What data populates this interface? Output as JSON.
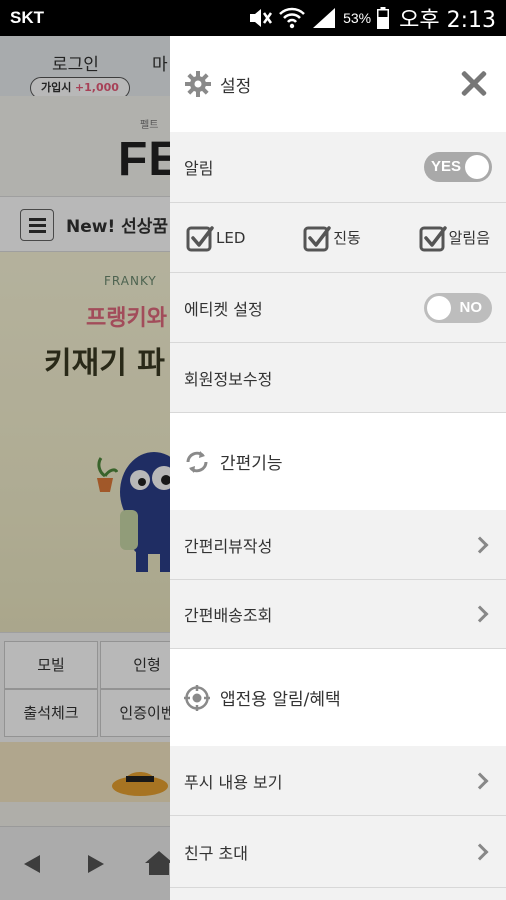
{
  "status_bar": {
    "carrier": "SKT",
    "battery_percent": "53%",
    "time": "오후 2:13"
  },
  "background_app": {
    "login": "로그인",
    "my_page_partial": "마",
    "join_badge_prefix": "가입시",
    "join_badge_points": "+1,000",
    "logo_small": "펠트",
    "logo": "FE",
    "notice": "New! 선상꿈",
    "banner_brand": "FRANKY",
    "banner_line1": "프랭키와",
    "banner_line2": "키재기 파",
    "grid": [
      "모빌",
      "인형",
      "출석체크",
      "인증이벤"
    ]
  },
  "drawer": {
    "header": {
      "title": "설정",
      "icon": "gear-icon",
      "close_icon": "close-icon"
    },
    "notification": {
      "label": "알림",
      "toggle_label": "YES",
      "toggle_state": "on"
    },
    "notification_options": [
      {
        "label": "LED",
        "checked": true
      },
      {
        "label": "진동",
        "checked": true
      },
      {
        "label": "알림음",
        "checked": true
      }
    ],
    "etiquette": {
      "label": "에티켓 설정",
      "toggle_label": "NO",
      "toggle_state": "off"
    },
    "member_info": {
      "label": "회원정보수정"
    },
    "quick_section": {
      "title": "간편기능",
      "icon": "refresh-icon"
    },
    "quick_items": [
      {
        "label": "간편리뷰작성"
      },
      {
        "label": "간편배송조회"
      }
    ],
    "app_section": {
      "title": "앱전용 알림/혜택",
      "icon": "target-icon"
    },
    "app_items": [
      {
        "label": "푸시 내용 보기"
      },
      {
        "label": "친구 초대"
      }
    ]
  }
}
